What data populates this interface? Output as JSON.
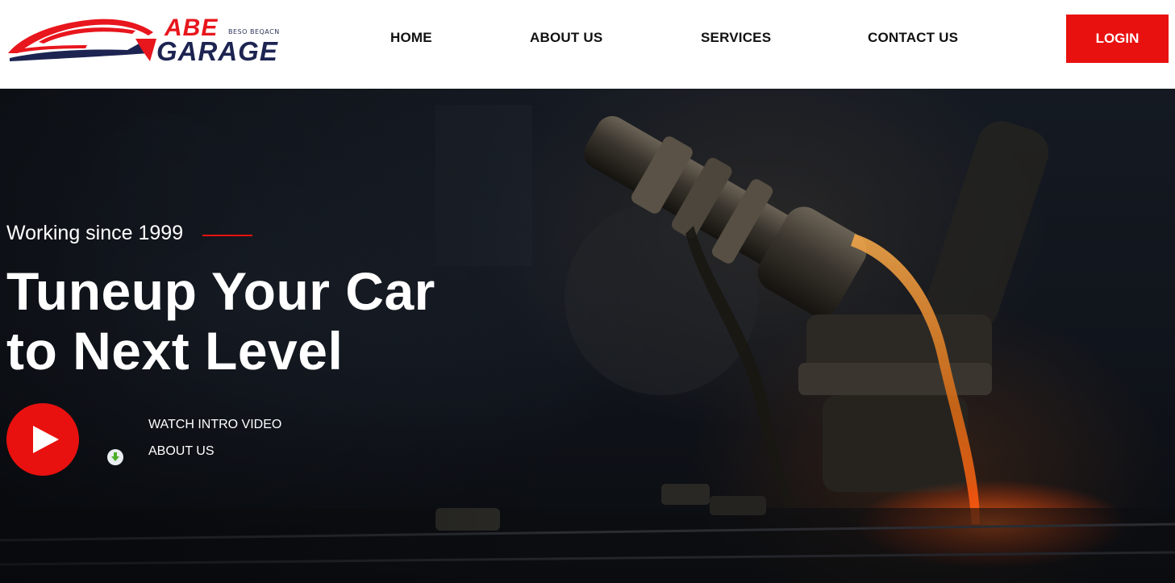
{
  "brand": {
    "name_top": "ABE",
    "tagline": "BESO BEQACN",
    "name_bottom": "GARAGE",
    "logo_icon": "car-swoosh-logo",
    "colors": {
      "red": "#e8161d",
      "navy": "#1d2451"
    }
  },
  "nav": {
    "items": [
      {
        "label": "HOME"
      },
      {
        "label": "ABOUT US"
      },
      {
        "label": "SERVICES"
      },
      {
        "label": "CONTACT US"
      }
    ],
    "login_label": "LOGIN",
    "accent": "#e8110f"
  },
  "hero": {
    "eyebrow": "Working since 1999",
    "headline_line1": "Tuneup Your Car",
    "headline_line2": "to Next Level",
    "play_icon": "play-icon",
    "intro_link": "WATCH INTRO VIDEO",
    "about_link": "ABOUT US",
    "about_icon": "download-arrow-icon"
  }
}
